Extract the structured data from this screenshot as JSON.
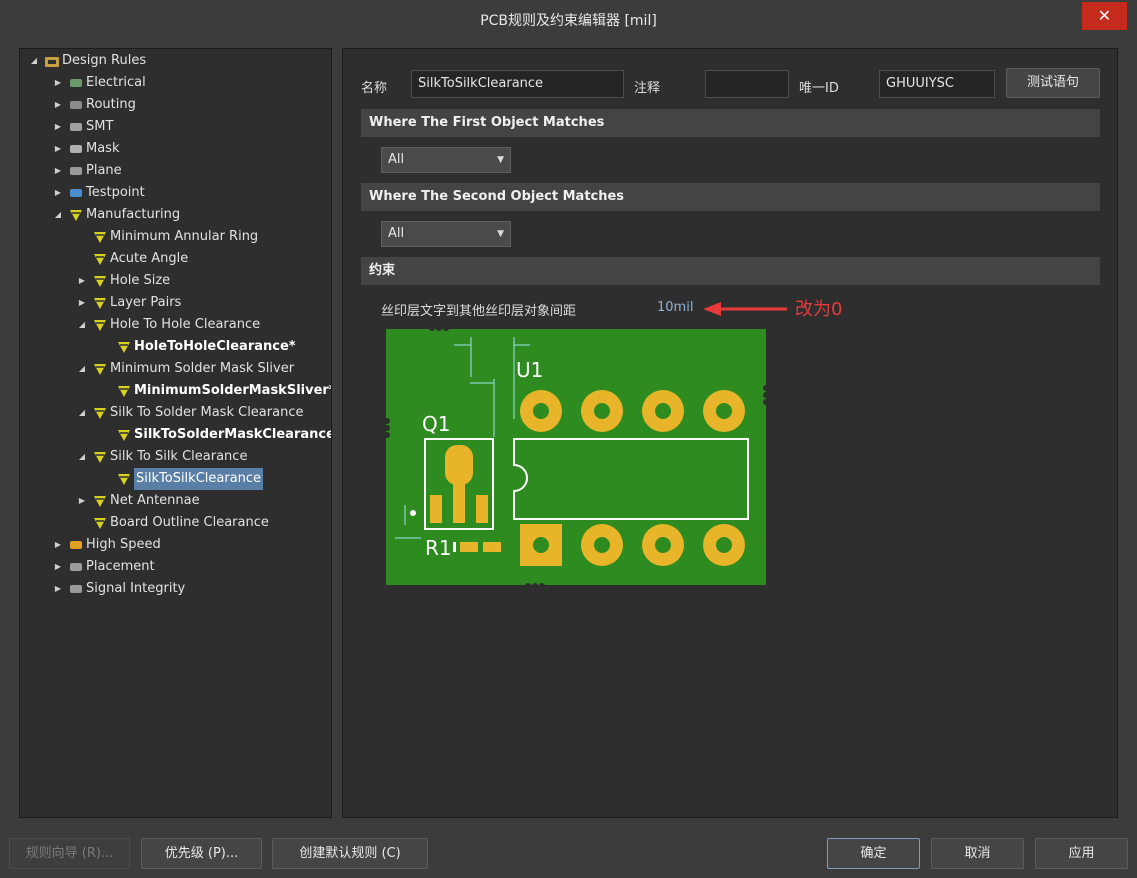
{
  "window": {
    "title": "PCB规则及约束编辑器 [mil]",
    "close_glyph": "✕"
  },
  "tree": {
    "items": [
      {
        "label": "Design Rules",
        "icon": "design-rules-icon",
        "level": 0,
        "expanded": true
      },
      {
        "label": "Electrical",
        "icon": "electrical-icon",
        "level": 1,
        "expanded": false
      },
      {
        "label": "Routing",
        "icon": "routing-icon",
        "level": 1,
        "expanded": false
      },
      {
        "label": "SMT",
        "icon": "smt-icon",
        "level": 1,
        "expanded": false
      },
      {
        "label": "Mask",
        "icon": "mask-icon",
        "level": 1,
        "expanded": false
      },
      {
        "label": "Plane",
        "icon": "plane-icon",
        "level": 1,
        "expanded": false
      },
      {
        "label": "Testpoint",
        "icon": "testpoint-icon",
        "level": 1,
        "expanded": false
      },
      {
        "label": "Manufacturing",
        "icon": "manufacturing-icon",
        "level": 1,
        "expanded": true
      },
      {
        "label": "Minimum Annular Ring",
        "icon": "rule-icon",
        "level": 2
      },
      {
        "label": "Acute Angle",
        "icon": "rule-icon",
        "level": 2
      },
      {
        "label": "Hole Size",
        "icon": "rule-icon",
        "level": 2,
        "expanded": false
      },
      {
        "label": "Layer Pairs",
        "icon": "rule-icon",
        "level": 2,
        "expanded": false
      },
      {
        "label": "Hole To Hole Clearance",
        "icon": "rule-icon",
        "level": 2,
        "expanded": true
      },
      {
        "label": "HoleToHoleClearance*",
        "icon": "rule-icon",
        "level": 3,
        "bold": true
      },
      {
        "label": "Minimum Solder Mask Sliver",
        "icon": "rule-icon",
        "level": 2,
        "expanded": true
      },
      {
        "label": "MinimumSolderMaskSliver*",
        "icon": "rule-icon",
        "level": 3,
        "bold": true
      },
      {
        "label": "Silk To Solder Mask Clearance",
        "icon": "rule-icon",
        "level": 2,
        "expanded": true
      },
      {
        "label": "SilkToSolderMaskClearance*",
        "icon": "rule-icon",
        "level": 3,
        "bold": true
      },
      {
        "label": "Silk To Silk Clearance",
        "icon": "rule-icon",
        "level": 2,
        "expanded": true
      },
      {
        "label": "SilkToSilkClearance",
        "icon": "rule-icon",
        "level": 3,
        "selected": true
      },
      {
        "label": "Net Antennae",
        "icon": "rule-icon",
        "level": 2,
        "expanded": false
      },
      {
        "label": "Board Outline Clearance",
        "icon": "rule-icon",
        "level": 2
      },
      {
        "label": "High Speed",
        "icon": "high-speed-icon",
        "level": 1,
        "expanded": false
      },
      {
        "label": "Placement",
        "icon": "placement-icon",
        "level": 1,
        "expanded": false
      },
      {
        "label": "Signal Integrity",
        "icon": "signal-integrity-icon",
        "level": 1,
        "expanded": false
      }
    ]
  },
  "rule": {
    "name_label": "名称",
    "name_value": "SilkToSilkClearance",
    "comment_label": "注释",
    "comment_value": "",
    "uid_label": "唯一ID",
    "uid_value": "GHUUIYSC",
    "test_button": "测试语句"
  },
  "sections": {
    "first": "Where The First Object Matches",
    "first_combo": "All",
    "second": "Where The Second Object Matches",
    "second_combo": "All",
    "constraints": "约束"
  },
  "constraint": {
    "label": "丝印层文字到其他丝印层对象间距",
    "value": "10mil",
    "annotation": "改为0"
  },
  "diagram": {
    "u1": "U1",
    "q1": "Q1",
    "r1": "R1"
  },
  "colors": {
    "board": "#2e8b1f",
    "pad": "#e8b52a",
    "silk": "#ffffff",
    "annotation": "#e83a3a",
    "selection": "#5a7fa6"
  },
  "footer": {
    "wizard": "规则向导 (R)...",
    "priority": "优先级 (P)...",
    "create_default": "创建默认规则 (C)",
    "ok": "确定",
    "cancel": "取消",
    "apply": "应用"
  }
}
